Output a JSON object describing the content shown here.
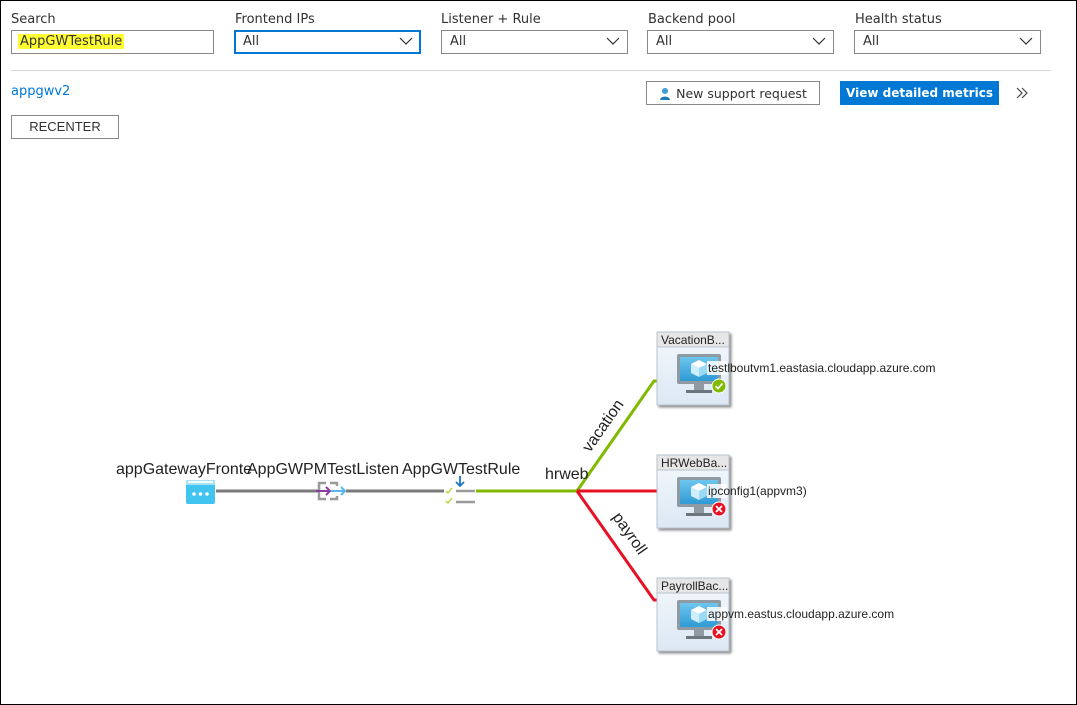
{
  "filters": {
    "search": {
      "label": "Search",
      "value": "AppGWTestRule"
    },
    "frontend_ips": {
      "label": "Frontend IPs",
      "value": "All"
    },
    "listener_rule": {
      "label": "Listener + Rule",
      "value": "All"
    },
    "backend_pool": {
      "label": "Backend pool",
      "value": "All"
    },
    "health_status": {
      "label": "Health status",
      "value": "All"
    }
  },
  "toolbar": {
    "gateway_link": "appgwv2",
    "recenter_label": "RECENTER",
    "support_label": "New support request",
    "metrics_label": "View detailed metrics",
    "more_icon": "double-chevron-right-icon"
  },
  "colors": {
    "accent": "#0078d4",
    "healthy_edge": "#7fba00",
    "unhealthy_edge": "#e81123",
    "neutral_edge": "#7a7a7a",
    "highlight": "#ffff33"
  },
  "topology": {
    "frontend": {
      "label": "appGatewayFronte",
      "icon": "frontend-ip-icon"
    },
    "listener": {
      "label": "AppGWPMTestListen",
      "icon": "listener-icon"
    },
    "rule": {
      "label": "AppGWTestRule",
      "icon": "rule-icon"
    },
    "http_setting": {
      "label": "hrweb"
    },
    "paths": [
      {
        "label": "vacation",
        "status": "healthy"
      },
      {
        "label": "",
        "status": "unhealthy"
      },
      {
        "label": "payroll",
        "status": "unhealthy"
      }
    ],
    "backend_pools": [
      {
        "title": "VacationB...",
        "server": "testlboutvm1.eastasia.cloudapp.azure.com",
        "status": "healthy",
        "status_icon": "check-circle-icon"
      },
      {
        "title": "HRWebBa...",
        "server": "ipconfig1(appvm3)",
        "status": "unhealthy",
        "status_icon": "error-circle-icon"
      },
      {
        "title": "PayrollBac...",
        "server": "appvm.eastus.cloudapp.azure.com",
        "status": "unhealthy",
        "status_icon": "error-circle-icon"
      }
    ]
  }
}
